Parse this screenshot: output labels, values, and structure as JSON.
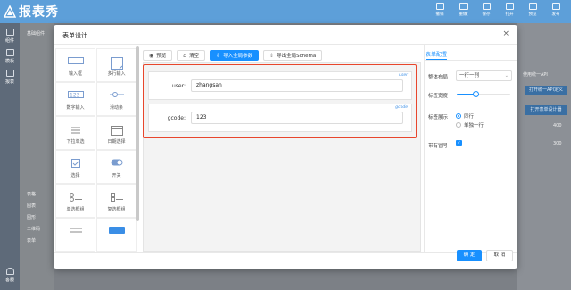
{
  "app": {
    "title": "报表秀",
    "top_tools": [
      "撤销",
      "重做",
      "保存",
      "打开",
      "预览",
      "发布"
    ],
    "left_nav": [
      "组件",
      "模板",
      "报表"
    ],
    "left_bottom": "客服",
    "panel_categories": [
      "表格",
      "图表",
      "图形",
      "二维码",
      "表单"
    ],
    "panel_first_label": "基础组件",
    "right_buttons": [
      "打开统一API定义",
      "打开表单设计器"
    ],
    "right_text": "使用统一API",
    "right_numbers": [
      "400",
      "300"
    ]
  },
  "dialog": {
    "title": "表单设计",
    "close": "×",
    "widgets": [
      {
        "label": "输入框",
        "icon": "input-icon"
      },
      {
        "label": "多行输入",
        "icon": "textarea-icon"
      },
      {
        "label": "数字输入",
        "icon": "number-input-icon"
      },
      {
        "label": "滑动条",
        "icon": "slider-icon"
      },
      {
        "label": "下拉单选",
        "icon": "dropdown-icon"
      },
      {
        "label": "日期选择",
        "icon": "calendar-icon"
      },
      {
        "label": "选择",
        "icon": "checkbox-icon"
      },
      {
        "label": "开关",
        "icon": "switch-icon"
      },
      {
        "label": "单选框组",
        "icon": "radio-group-icon"
      },
      {
        "label": "复选框组",
        "icon": "checkbox-group-icon"
      },
      {
        "label": "",
        "icon": "widget-icon"
      },
      {
        "label": "",
        "icon": "button-widget-icon"
      }
    ],
    "toolbar": {
      "preview": "预览",
      "clear": "清空",
      "import": "导入全局参数",
      "export": "导出全局Schema"
    },
    "fields": [
      {
        "tag": "user",
        "label": "user:",
        "value": "zhangsan"
      },
      {
        "tag": "gcode",
        "label": "gcode:",
        "value": "123"
      }
    ],
    "props": {
      "tab": "表单配置",
      "layout_label": "整体布局",
      "layout_value": "一行一列",
      "label_width_label": "标签宽度",
      "label_width_value": 0.35,
      "label_display_label": "标签展示",
      "display_options": [
        "同行",
        "单独一行"
      ],
      "display_selected": 0,
      "colon_label": "带有冒号",
      "colon_checked": true
    },
    "ok": "确 定",
    "cancel": "取 消"
  }
}
